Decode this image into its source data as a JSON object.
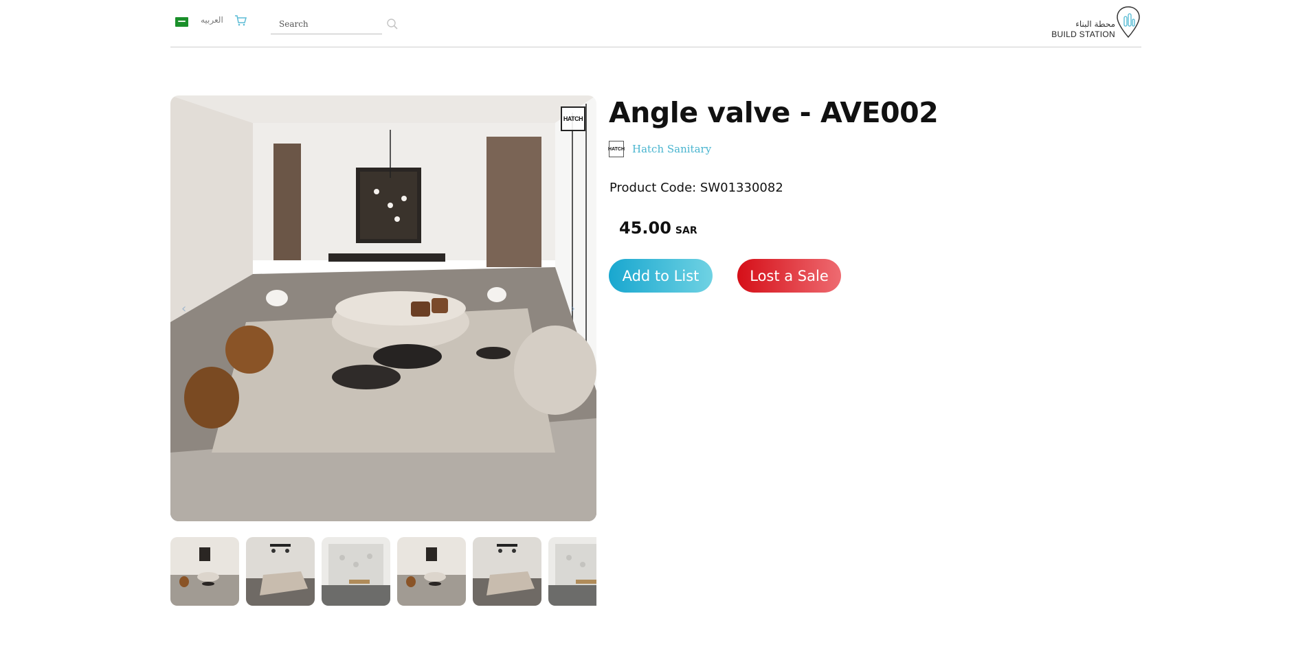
{
  "header": {
    "language_label": "العربيه",
    "search_placeholder": "Search",
    "logo_arabic": "محطة البناء",
    "logo_english": "BUILD STATION",
    "icons": {
      "flag": "saudi-flag-icon",
      "cart": "cart-icon",
      "search": "search-icon",
      "logo": "location-pin-logo"
    }
  },
  "gallery": {
    "badge_text": "HATCH",
    "prev_arrow": "‹",
    "next_arrow": "›",
    "thumbnail_count": 6
  },
  "product": {
    "title": "Angle valve - AVE002",
    "brand_icon_text": "HATCH",
    "brand_name": "Hatch Sanitary",
    "code_label": "Product Code: SW01330082",
    "price": "45.00",
    "currency": "SAR",
    "add_to_list_label": "Add to List",
    "lost_sale_label": "Lost a Sale"
  },
  "colors": {
    "accent_blue": "#19a7cf",
    "accent_red": "#d50f18",
    "brand_link": "#48b4cf"
  }
}
